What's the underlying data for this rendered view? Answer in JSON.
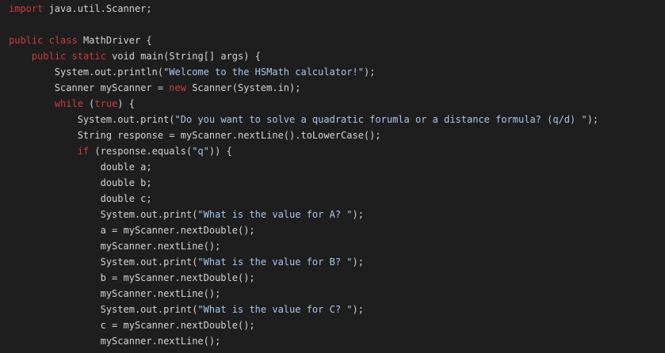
{
  "colors": {
    "background": "#1e1e1e",
    "plain": "#d4d4d4",
    "keyword": "#cc3d3d",
    "string": "#a8c7f0"
  },
  "code": {
    "lines": [
      {
        "indent": "",
        "tokens": [
          {
            "t": "kw",
            "v": "import"
          },
          {
            "t": "plain",
            "v": " java.util.Scanner;"
          }
        ]
      },
      {
        "indent": "",
        "tokens": []
      },
      {
        "indent": "",
        "tokens": [
          {
            "t": "kw",
            "v": "public"
          },
          {
            "t": "plain",
            "v": " "
          },
          {
            "t": "kw",
            "v": "class"
          },
          {
            "t": "plain",
            "v": " MathDriver {"
          }
        ]
      },
      {
        "indent": "    ",
        "tokens": [
          {
            "t": "kw",
            "v": "public"
          },
          {
            "t": "plain",
            "v": " "
          },
          {
            "t": "kw",
            "v": "static"
          },
          {
            "t": "plain",
            "v": " void main(String[] args) {"
          }
        ]
      },
      {
        "indent": "        ",
        "tokens": [
          {
            "t": "plain",
            "v": "System.out.println("
          },
          {
            "t": "str",
            "v": "\"Welcome to the HSMath calculator!\""
          },
          {
            "t": "plain",
            "v": ");"
          }
        ]
      },
      {
        "indent": "        ",
        "tokens": [
          {
            "t": "plain",
            "v": "Scanner myScanner = "
          },
          {
            "t": "kw",
            "v": "new"
          },
          {
            "t": "plain",
            "v": " Scanner(System.in);"
          }
        ]
      },
      {
        "indent": "        ",
        "tokens": [
          {
            "t": "kw",
            "v": "while"
          },
          {
            "t": "plain",
            "v": " ("
          },
          {
            "t": "kw",
            "v": "true"
          },
          {
            "t": "plain",
            "v": ") {"
          }
        ]
      },
      {
        "indent": "            ",
        "tokens": [
          {
            "t": "plain",
            "v": "System.out.print("
          },
          {
            "t": "str",
            "v": "\"Do you want to solve a quadratic forumla or a distance formula? (q/d) \""
          },
          {
            "t": "plain",
            "v": ");"
          }
        ]
      },
      {
        "indent": "            ",
        "tokens": [
          {
            "t": "plain",
            "v": "String response = myScanner.nextLine().toLowerCase();"
          }
        ]
      },
      {
        "indent": "            ",
        "tokens": [
          {
            "t": "kw",
            "v": "if"
          },
          {
            "t": "plain",
            "v": " (response.equals("
          },
          {
            "t": "str",
            "v": "\"q\""
          },
          {
            "t": "plain",
            "v": ")) {"
          }
        ]
      },
      {
        "indent": "                ",
        "tokens": [
          {
            "t": "plain",
            "v": "double a;"
          }
        ]
      },
      {
        "indent": "                ",
        "tokens": [
          {
            "t": "plain",
            "v": "double b;"
          }
        ]
      },
      {
        "indent": "                ",
        "tokens": [
          {
            "t": "plain",
            "v": "double c;"
          }
        ]
      },
      {
        "indent": "                ",
        "tokens": [
          {
            "t": "plain",
            "v": "System.out.print("
          },
          {
            "t": "str",
            "v": "\"What is the value for A? \""
          },
          {
            "t": "plain",
            "v": ");"
          }
        ]
      },
      {
        "indent": "                ",
        "tokens": [
          {
            "t": "plain",
            "v": "a = myScanner.nextDouble();"
          }
        ]
      },
      {
        "indent": "                ",
        "tokens": [
          {
            "t": "plain",
            "v": "myScanner.nextLine();"
          }
        ]
      },
      {
        "indent": "                ",
        "tokens": [
          {
            "t": "plain",
            "v": "System.out.print("
          },
          {
            "t": "str",
            "v": "\"What is the value for B? \""
          },
          {
            "t": "plain",
            "v": ");"
          }
        ]
      },
      {
        "indent": "                ",
        "tokens": [
          {
            "t": "plain",
            "v": "b = myScanner.nextDouble();"
          }
        ]
      },
      {
        "indent": "                ",
        "tokens": [
          {
            "t": "plain",
            "v": "myScanner.nextLine();"
          }
        ]
      },
      {
        "indent": "                ",
        "tokens": [
          {
            "t": "plain",
            "v": "System.out.print("
          },
          {
            "t": "str",
            "v": "\"What is the value for C? \""
          },
          {
            "t": "plain",
            "v": ");"
          }
        ]
      },
      {
        "indent": "                ",
        "tokens": [
          {
            "t": "plain",
            "v": "c = myScanner.nextDouble();"
          }
        ]
      },
      {
        "indent": "                ",
        "tokens": [
          {
            "t": "plain",
            "v": "myScanner.nextLine();"
          }
        ]
      }
    ]
  }
}
